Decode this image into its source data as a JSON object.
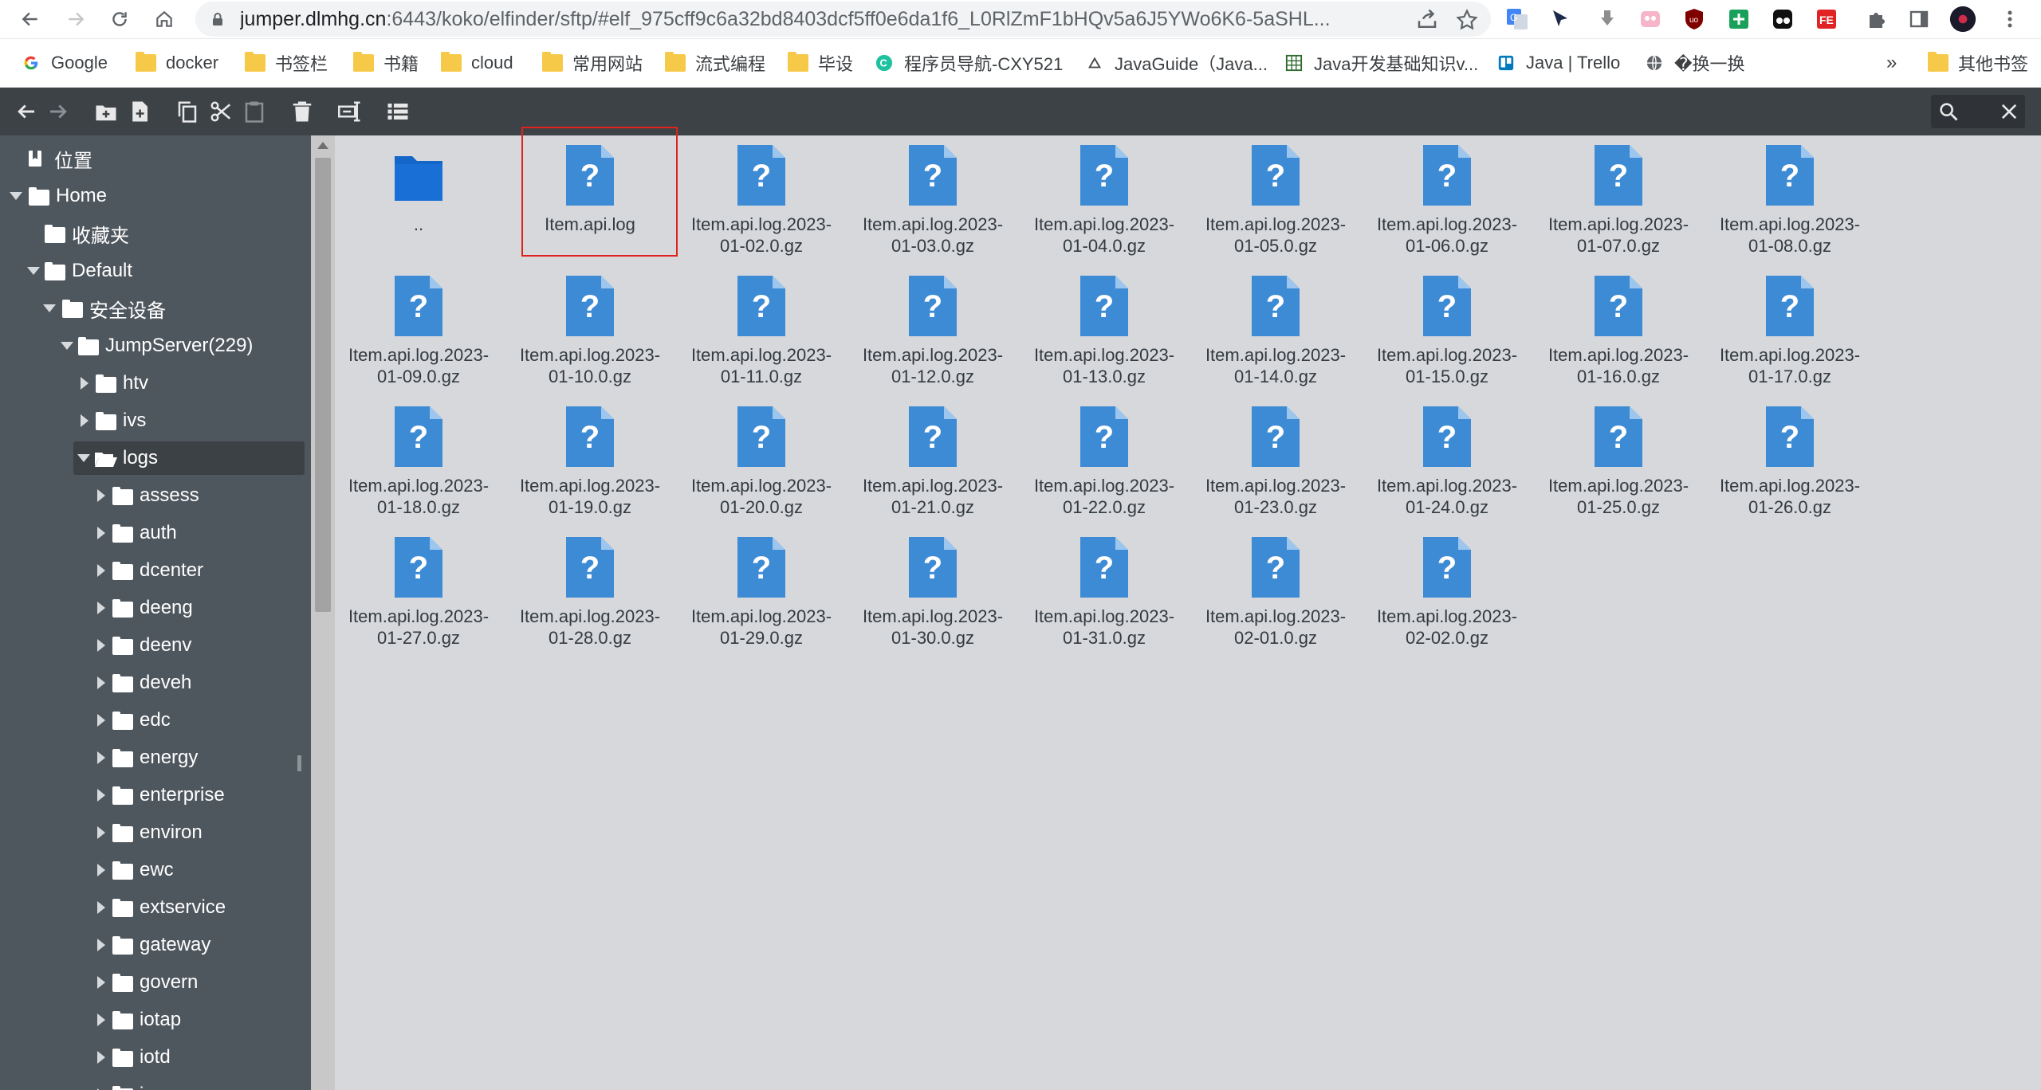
{
  "browser": {
    "url_host": "jumper.dlmhg.cn",
    "url_rest": ":6443/koko/elfinder/sftp/#elf_975cff9c6a32bd8403dcf5ff0e6da1f6_L0RlZmF1bHQv5a6J5YWo6K6-5aSHL...",
    "bookmarks": [
      {
        "label": "Google",
        "icon": "google-icon"
      },
      {
        "label": "docker",
        "icon": "folder-icon"
      },
      {
        "label": "书签栏",
        "icon": "folder-icon"
      },
      {
        "label": "书籍",
        "icon": "folder-icon"
      },
      {
        "label": "cloud",
        "icon": "folder-icon"
      },
      {
        "label": "常用网站",
        "icon": "folder-icon"
      },
      {
        "label": "流式编程",
        "icon": "folder-icon"
      },
      {
        "label": "毕设",
        "icon": "folder-icon"
      },
      {
        "label": "程序员导航-CXY521",
        "icon": "c-logo-icon"
      },
      {
        "label": "JavaGuide（Java...",
        "icon": "javaguide-icon"
      },
      {
        "label": "Java开发基础知识v...",
        "icon": "java-grid-icon"
      },
      {
        "label": "Java | Trello",
        "icon": "trello-icon"
      },
      {
        "label": "�换一换",
        "icon": "globe-icon"
      }
    ],
    "bookmarks_overflow": "»",
    "other_bookmarks": "其他书签"
  },
  "tree": {
    "places": "位置",
    "home": "Home",
    "favorites": "收藏夹",
    "default": "Default",
    "security": "安全设备",
    "jumpserver": "JumpServer(229)",
    "folders_top": [
      "htv",
      "ivs"
    ],
    "logs": "logs",
    "log_folders": [
      "assess",
      "auth",
      "dcenter",
      "deeng",
      "deenv",
      "deveh",
      "edc",
      "energy",
      "enterprise",
      "environ",
      "ewc",
      "extservice",
      "gateway",
      "govern",
      "iotap",
      "iotd",
      "i..."
    ]
  },
  "files": {
    "parent": "..",
    "items": [
      "Item.api.log",
      "Item.api.log.2023-\n01-02.0.gz",
      "Item.api.log.2023-\n01-03.0.gz",
      "Item.api.log.2023-\n01-04.0.gz",
      "Item.api.log.2023-\n01-05.0.gz",
      "Item.api.log.2023-\n01-06.0.gz",
      "Item.api.log.2023-\n01-07.0.gz",
      "Item.api.log.2023-\n01-08.0.gz",
      "Item.api.log.2023-\n01-09.0.gz",
      "Item.api.log.2023-\n01-10.0.gz",
      "Item.api.log.2023-\n01-11.0.gz",
      "Item.api.log.2023-\n01-12.0.gz",
      "Item.api.log.2023-\n01-13.0.gz",
      "Item.api.log.2023-\n01-14.0.gz",
      "Item.api.log.2023-\n01-15.0.gz",
      "Item.api.log.2023-\n01-16.0.gz",
      "Item.api.log.2023-\n01-17.0.gz",
      "Item.api.log.2023-\n01-18.0.gz",
      "Item.api.log.2023-\n01-19.0.gz",
      "Item.api.log.2023-\n01-20.0.gz",
      "Item.api.log.2023-\n01-21.0.gz",
      "Item.api.log.2023-\n01-22.0.gz",
      "Item.api.log.2023-\n01-23.0.gz",
      "Item.api.log.2023-\n01-24.0.gz",
      "Item.api.log.2023-\n01-25.0.gz",
      "Item.api.log.2023-\n01-26.0.gz",
      "Item.api.log.2023-\n01-27.0.gz",
      "Item.api.log.2023-\n01-28.0.gz",
      "Item.api.log.2023-\n01-29.0.gz",
      "Item.api.log.2023-\n01-30.0.gz",
      "Item.api.log.2023-\n01-31.0.gz",
      "Item.api.log.2023-\n02-01.0.gz",
      "Item.api.log.2023-\n02-02.0.gz"
    ]
  },
  "colors": {
    "toolbar": "#3d4247",
    "tree_bg": "#4f575e",
    "files_bg": "#d6d8dc",
    "file_icon": "#3d8bd4",
    "folder_icon": "#1467c9",
    "highlight": "#e0221d"
  }
}
